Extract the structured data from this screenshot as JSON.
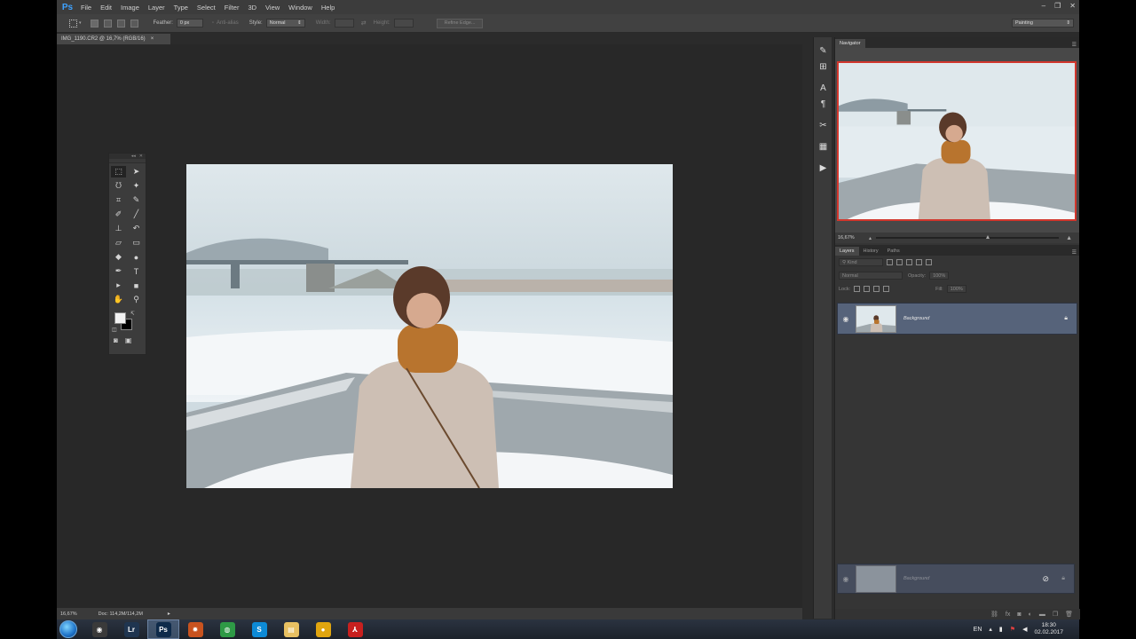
{
  "app": {
    "logo": "Ps",
    "menu": [
      "File",
      "Edit",
      "Image",
      "Layer",
      "Type",
      "Select",
      "Filter",
      "3D",
      "View",
      "Window",
      "Help"
    ],
    "window_controls": [
      "–",
      "❐",
      "✕"
    ]
  },
  "options": {
    "feather_label": "Feather:",
    "feather_value": "0 px",
    "antialias_label": "Anti-alias",
    "style_label": "Style:",
    "style_value": "Normal",
    "width_label": "Width:",
    "height_label": "Height:",
    "refine_edge": "Refine Edge...",
    "workspace": "Painting"
  },
  "document": {
    "tab_title": "IMG_1190.CR2 @ 16,7% (RGB/16)",
    "tab_close": "×",
    "zoom_status": "16,67%",
    "doc_info": "Doc: 114,2M/114,2M"
  },
  "navigator": {
    "tab": "Navigator",
    "zoom": "16,67%"
  },
  "layers_panel": {
    "tabs": [
      "Layers",
      "History",
      "Paths"
    ],
    "kind": "Kind",
    "blend_mode": "Normal",
    "opacity_label": "Opacity:",
    "opacity_value": "100%",
    "lock_label": "Lock:",
    "fill_label": "Fill:",
    "fill_value": "100%",
    "layer_name": "Background",
    "ghost_layer_name": "Background"
  },
  "taskbar": {
    "apps": [
      {
        "name": "obs",
        "label": "◉",
        "color": "#3a3a3a"
      },
      {
        "name": "lightroom",
        "label": "Lr",
        "color": "#1f3550"
      },
      {
        "name": "photoshop",
        "label": "Ps",
        "color": "#0e2a4a"
      },
      {
        "name": "settings",
        "label": "✹",
        "color": "#c8531f"
      },
      {
        "name": "chrome",
        "label": "◍",
        "color": "#2e9a46"
      },
      {
        "name": "skype",
        "label": "S",
        "color": "#0d8ad6"
      },
      {
        "name": "explorer",
        "label": "▤",
        "color": "#e7c062"
      },
      {
        "name": "app-yellow",
        "label": "●",
        "color": "#e0a50f"
      },
      {
        "name": "acrobat",
        "label": "⅄",
        "color": "#c8201f"
      }
    ],
    "language": "EN",
    "time": "18:30",
    "date": "02.02.2017"
  },
  "colors": {
    "accent_red": "#d1362c",
    "layer_selected": "#56637a",
    "ps_blue": "#3ea2ff"
  }
}
